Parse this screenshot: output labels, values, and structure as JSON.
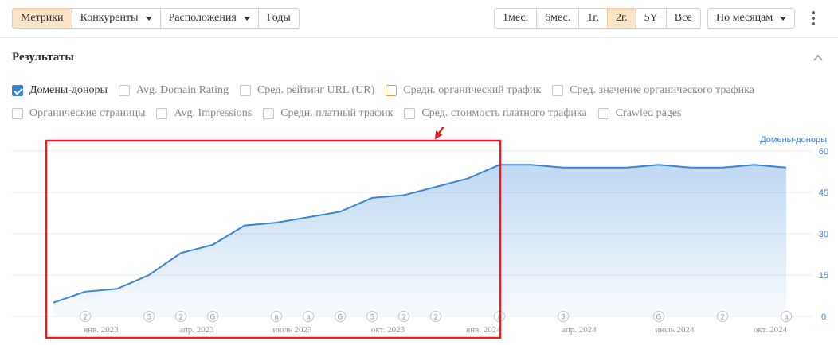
{
  "toolbar": {
    "left_tabs": [
      {
        "label": "Метрики",
        "active": true,
        "dropdown": false
      },
      {
        "label": "Конкуренты",
        "active": false,
        "dropdown": true
      },
      {
        "label": "Расположения",
        "active": false,
        "dropdown": true
      },
      {
        "label": "Годы",
        "active": false,
        "dropdown": false
      }
    ],
    "ranges": [
      {
        "label": "1мес.",
        "active": false
      },
      {
        "label": "6мес.",
        "active": false
      },
      {
        "label": "1г.",
        "active": false
      },
      {
        "label": "2г.",
        "active": true
      },
      {
        "label": "5Y",
        "active": false
      },
      {
        "label": "Все",
        "active": false
      }
    ],
    "grouping": "По месяцам",
    "more_icon": "kebab-icon"
  },
  "results": {
    "title": "Результаты",
    "collapse_icon": "chevron-up-icon"
  },
  "metrics_row1": [
    {
      "label": "Домены-доноры",
      "checked": true
    },
    {
      "label": "Avg. Domain Rating",
      "checked": false
    },
    {
      "label": "Сред. рейтинг URL (UR)",
      "checked": false
    },
    {
      "label": "Средн. органический трафик",
      "checked": false,
      "accent": "#e8a13a"
    },
    {
      "label": "Сред. значение органического трафика",
      "checked": false
    }
  ],
  "metrics_row2": [
    {
      "label": "Органические страницы",
      "checked": false
    },
    {
      "label": "Avg. Impressions",
      "checked": false
    },
    {
      "label": "Средн. платный трафик",
      "checked": false
    },
    {
      "label": "Сред. стоимость платного трафика",
      "checked": false
    },
    {
      "label": "Crawled pages",
      "checked": false
    }
  ],
  "chart_data": {
    "type": "area",
    "series": [
      {
        "name": "Домены-доноры",
        "color": "#3a86d4",
        "values": [
          5,
          9,
          10,
          15,
          23,
          26,
          33,
          34,
          36,
          38,
          43,
          44,
          47,
          50,
          55,
          55,
          54,
          54,
          54,
          55,
          54,
          54,
          55,
          54
        ]
      }
    ],
    "x_tick_labels": [
      {
        "label": "янв. 2023",
        "index": 1.5
      },
      {
        "label": "апр. 2023",
        "index": 4.5
      },
      {
        "label": "июль 2023",
        "index": 7.5
      },
      {
        "label": "окт. 2023",
        "index": 10.5
      },
      {
        "label": "янв. 2024",
        "index": 13.5
      },
      {
        "label": "апр. 2024",
        "index": 16.5
      },
      {
        "label": "июль 2024",
        "index": 19.5
      },
      {
        "label": "окт. 2024",
        "index": 22.5
      }
    ],
    "y_axis_label": "Домены-доноры",
    "y_ticks": [
      0,
      15,
      30,
      45,
      60
    ],
    "ylim": [
      0,
      60
    ],
    "grid": true,
    "markers": [
      {
        "index": 1,
        "symbol": "2"
      },
      {
        "index": 3,
        "symbol": "G"
      },
      {
        "index": 4,
        "symbol": "2"
      },
      {
        "index": 5,
        "symbol": "G"
      },
      {
        "index": 7,
        "symbol": "a"
      },
      {
        "index": 8,
        "symbol": "a"
      },
      {
        "index": 9,
        "symbol": "G"
      },
      {
        "index": 10,
        "symbol": "G"
      },
      {
        "index": 11,
        "symbol": "2"
      },
      {
        "index": 12,
        "symbol": "2"
      },
      {
        "index": 14,
        "symbol": "a"
      },
      {
        "index": 16,
        "symbol": "3"
      },
      {
        "index": 19,
        "symbol": "G"
      },
      {
        "index": 21,
        "symbol": "2"
      },
      {
        "index": 23,
        "symbol": "a"
      }
    ],
    "highlight": {
      "from_index": 0,
      "to_index": 14,
      "color": "#e31e24"
    }
  }
}
